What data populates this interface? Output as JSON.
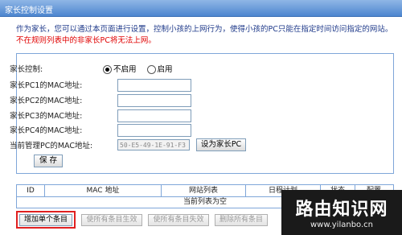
{
  "title": "家长控制设置",
  "description": "作为家长，您可以通过本页面进行设置，控制小孩的上网行为，使得小孩的PC只能在指定时间访问指定的网站。",
  "warning": "不在规则列表中的非家长PC将无法上网。",
  "form": {
    "parental_control_label": "家长控制:",
    "disable_label": "不启用",
    "enable_label": "启用",
    "selected": "不启用",
    "pc1_label": "家长PC1的MAC地址:",
    "pc2_label": "家长PC2的MAC地址:",
    "pc3_label": "家长PC3的MAC地址:",
    "pc4_label": "家长PC4的MAC地址:",
    "current_pc_label": "当前管理PC的MAC地址:",
    "current_mac": "50-E5-49-1E-91-F3",
    "set_as_parent_button": "设为家长PC",
    "save_button": "保 存"
  },
  "table": {
    "columns": [
      "ID",
      "MAC 地址",
      "网站列表",
      "日程计划",
      "状态",
      "配置"
    ],
    "empty_text": "当前列表为空"
  },
  "actions": {
    "add_single": "增加单个条目",
    "enable_all": "使所有条目生效",
    "disable_all": "使所有条目失效",
    "delete_all": "删除所有条目"
  },
  "watermark": {
    "title": "路由知识网",
    "url": "www.yilanbo.cn"
  }
}
